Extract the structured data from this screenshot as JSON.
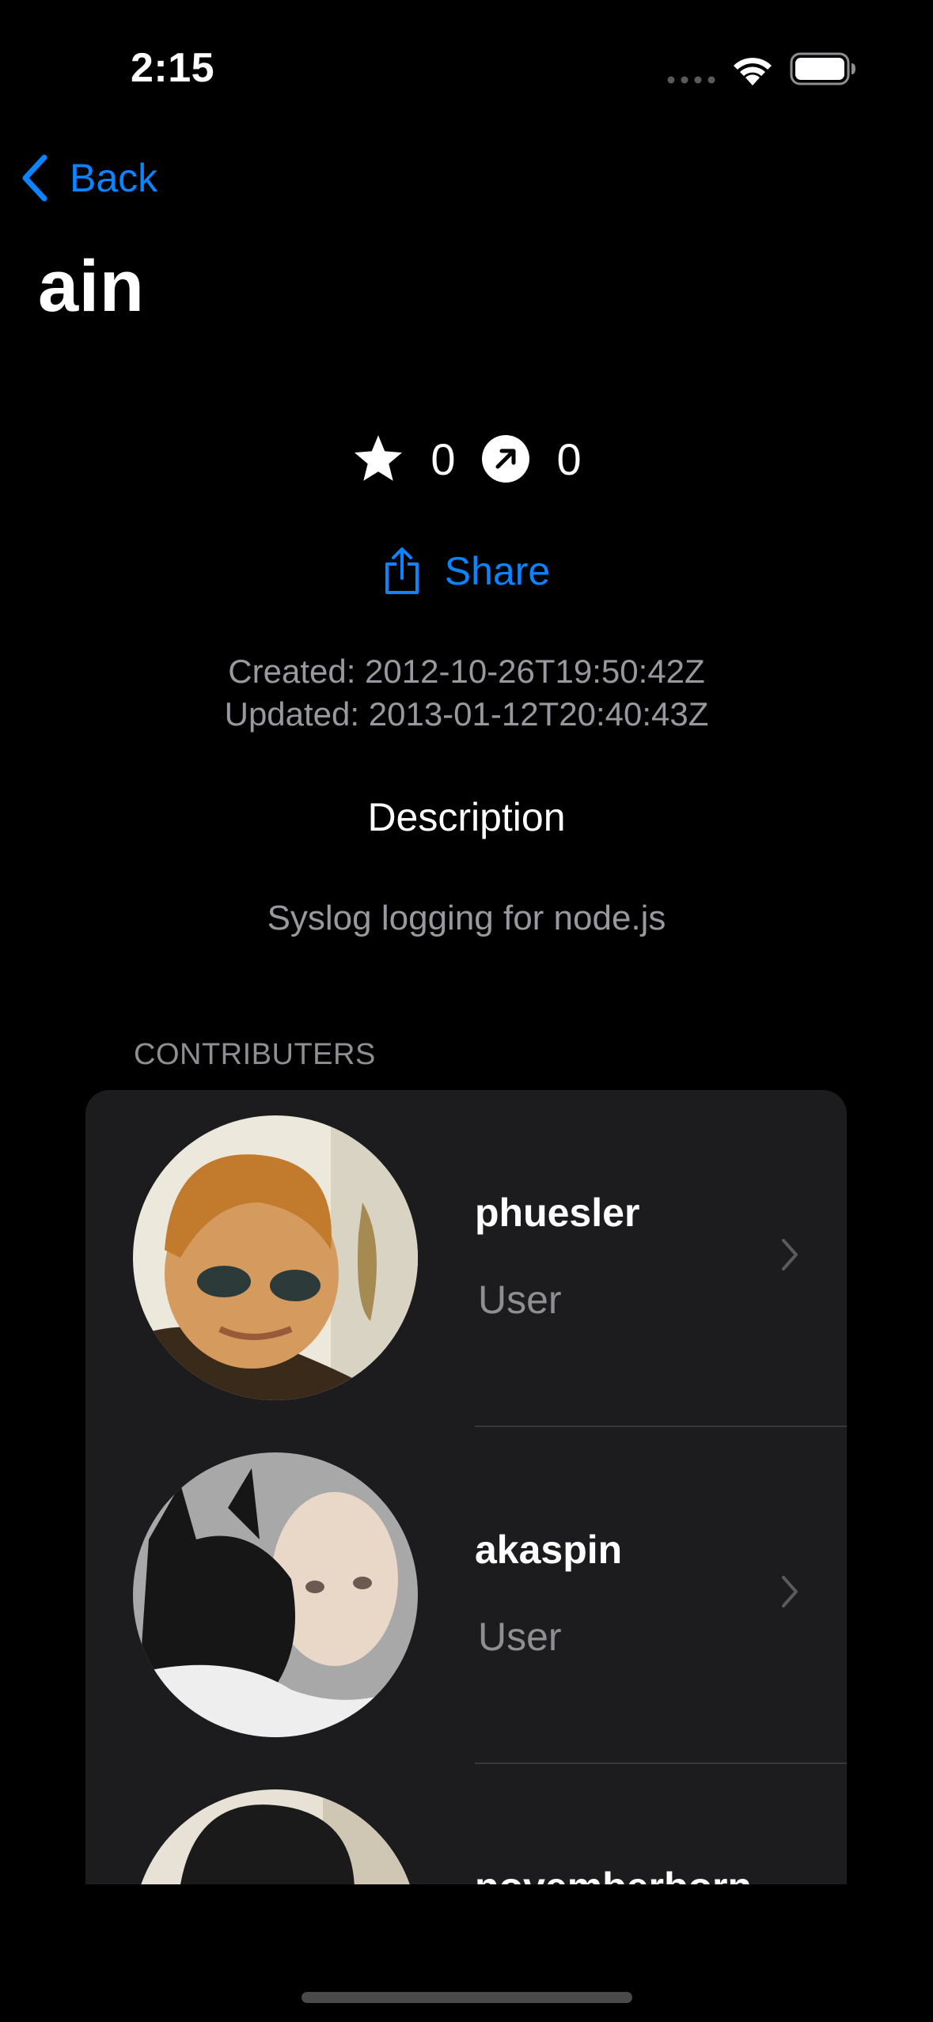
{
  "status_bar": {
    "time": "2:15"
  },
  "nav": {
    "back_label": "Back"
  },
  "title": "ain",
  "stats": {
    "stars": "0",
    "forks": "0"
  },
  "share_label": "Share",
  "dates": {
    "created": "Created: 2012-10-26T19:50:42Z",
    "updated": "Updated: 2013-01-12T20:40:43Z"
  },
  "description": {
    "heading": "Description",
    "text": "Syslog logging for node.js"
  },
  "contributors": {
    "header": "CONTRIBUTERS",
    "items": [
      {
        "name": "phuesler",
        "type": "User"
      },
      {
        "name": "akaspin",
        "type": "User"
      },
      {
        "name": "novemberborn",
        "type": ""
      }
    ]
  },
  "colors": {
    "accent": "#0a84ff",
    "background": "#000000",
    "card": "#1c1c1e",
    "secondary_text": "#98989e"
  }
}
